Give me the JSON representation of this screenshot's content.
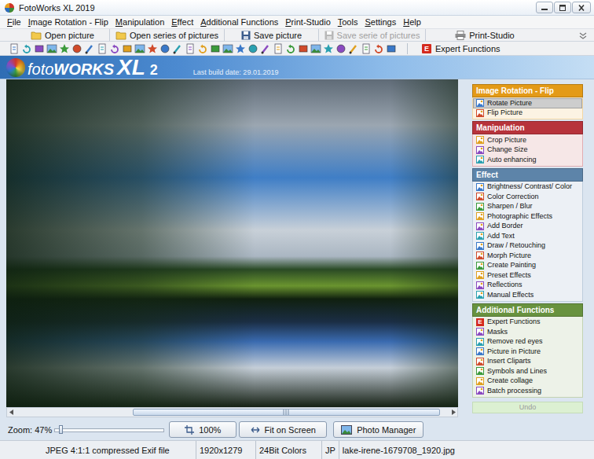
{
  "window": {
    "title": "FotoWorks XL 2019"
  },
  "menu": [
    "File",
    "Image Rotation - Flip",
    "Manipulation",
    "Effect",
    "Additional Functions",
    "Print-Studio",
    "Tools",
    "Settings",
    "Help"
  ],
  "quickbar": [
    {
      "label": "Open picture",
      "disabled": false
    },
    {
      "label": "Open series of pictures",
      "disabled": false
    },
    {
      "label": "Save picture",
      "disabled": false
    },
    {
      "label": "Save serie of pictures",
      "disabled": true
    },
    {
      "label": "Print-Studio",
      "disabled": false
    }
  ],
  "toolbar": {
    "expert": {
      "badge": "E",
      "label": "Expert Functions"
    }
  },
  "banner": {
    "logo": [
      "foto",
      "WORKS",
      "XL",
      "2"
    ],
    "build": "Last build date: 29.01.2019"
  },
  "scrollbar": {
    "offset": 0.27,
    "level": 0.71
  },
  "sections": [
    {
      "title": "Image Rotation - Flip",
      "color": "#e39a17",
      "items": [
        {
          "label": "Rotate Picture",
          "selected": true
        },
        {
          "label": "Flip Picture",
          "selected": false
        }
      ]
    },
    {
      "title": "Manipulation",
      "color": "#b7333b",
      "items": [
        {
          "label": "Crop Picture",
          "selected": false
        },
        {
          "label": "Change Size",
          "selected": false
        },
        {
          "label": "Auto enhancing",
          "selected": false
        }
      ]
    },
    {
      "title": "Effect",
      "color": "#5d84a9",
      "items": [
        {
          "label": "Brightness/ Contrast/ Color",
          "selected": false
        },
        {
          "label": "Color Correction",
          "selected": false
        },
        {
          "label": "Sharpen / Blur",
          "selected": false
        },
        {
          "label": "Photographic Effects",
          "selected": false
        },
        {
          "label": "Add Border",
          "selected": false
        },
        {
          "label": "Add Text",
          "selected": false
        },
        {
          "label": "Draw / Retouching",
          "selected": false
        },
        {
          "label": "Morph Picture",
          "selected": false
        },
        {
          "label": "Create Painting",
          "selected": false
        },
        {
          "label": "Preset Effects",
          "selected": false
        },
        {
          "label": "Reflections",
          "selected": false
        },
        {
          "label": "Manual Effects",
          "selected": false
        }
      ]
    },
    {
      "title": "Additional Functions",
      "color": "#68923f",
      "items": [
        {
          "label": "Expert Functions",
          "selected": false,
          "badge": "E"
        },
        {
          "label": "Masks",
          "selected": false
        },
        {
          "label": "Remove red eyes",
          "selected": false
        },
        {
          "label": "Picture in Picture",
          "selected": false
        },
        {
          "label": "Insert Cliparts",
          "selected": false
        },
        {
          "label": "Symbols and Lines",
          "selected": false
        },
        {
          "label": "Create collage",
          "selected": false
        },
        {
          "label": "Batch processing",
          "selected": false
        }
      ]
    }
  ],
  "undo": {
    "label": "Undo",
    "disabled": true
  },
  "zoom": {
    "label": "Zoom: 47%",
    "level": 0.03
  },
  "view_buttons": [
    "100%",
    "Fit on Screen",
    "Photo Manager"
  ],
  "status_bar": [
    "JPEG 4:1:1 compressed Exif file",
    "1920x1279",
    "24Bit Colors",
    "JP",
    "lake-irene-1679708_1920.jpg"
  ]
}
